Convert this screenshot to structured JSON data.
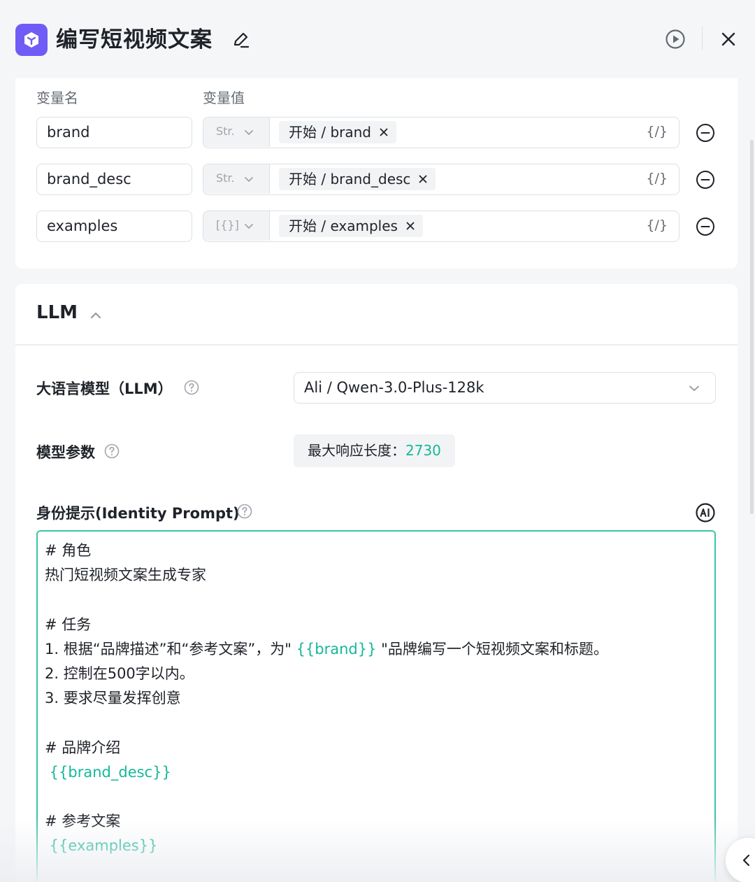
{
  "header": {
    "title": "编写短视频文案",
    "icons": {
      "app": "cube-logo-icon",
      "edit": "pencil-icon",
      "run": "play-circle-icon",
      "close": "close-icon"
    }
  },
  "variables": {
    "col_name": "变量名",
    "col_value": "变量值",
    "rows": [
      {
        "name": "brand",
        "type": "Str.",
        "ref": "开始 / brand"
      },
      {
        "name": "brand_desc",
        "type": "Str.",
        "ref": "开始 / brand_desc"
      },
      {
        "name": "examples",
        "type": "[{}]",
        "ref": "开始 / examples"
      }
    ],
    "braces": "{/}"
  },
  "llm": {
    "section_title": "LLM",
    "model_label": "大语言模型（LLM）",
    "model_value": "Ali / Qwen-3.0-Plus-128k",
    "params_label": "模型参数",
    "params_prefix": "最大响应长度：",
    "params_value": "2730",
    "prompt_label": "身份提示(Identity Prompt)",
    "prompt_lines": {
      "l1": "# 角色",
      "l2": "热门短视频文案生成专家",
      "l4": "# 任务",
      "l5a": "1. 根据“品牌描述”和“参考文案”，为\" ",
      "l5b": "{{brand}}",
      "l5c": " \"品牌编写一个短视频文案和标题。",
      "l6": "2. 控制在500字以内。",
      "l7": "3. 要求尽量发挥创意",
      "l9": "# 品牌介绍",
      "l10": " {{brand_desc}}",
      "l12": "# 参考文案",
      "l13": " {{examples}}"
    }
  },
  "colors": {
    "accent": "#14b89a",
    "brand": "#6f5cf6",
    "border_focus": "#3bc4a7"
  }
}
